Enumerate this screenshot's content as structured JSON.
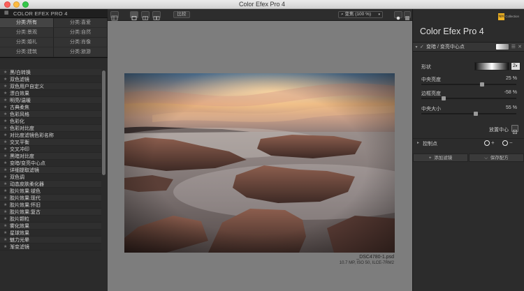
{
  "window": {
    "title": "Color Efex Pro 4"
  },
  "left_panel": {
    "header": "COLOR EFEX PRO 4",
    "categories": [
      "分类:所有",
      "分类:喜爱",
      "分类:景观",
      "分类:自然",
      "分类:婚礼",
      "分类:肖像",
      "分类:建筑",
      "分类:旅游"
    ],
    "filters": [
      "黑/白转换",
      "双色滤镜",
      "双色用户自定义",
      "漂白效果",
      "明亮/温暖",
      "古典柔焦",
      "色彩风格",
      "色彩化",
      "色彩对比度",
      "对比度滤镜色彩名称",
      "交叉平衡",
      "交叉冲印",
      "黑暗对比度",
      "变暗/变亮中心点",
      "详细提取滤镜",
      "双色调",
      "动态皮肤柔化器",
      "胶片效果:褪色",
      "胶片效果:现代",
      "胶片效果:怀旧",
      "胶片效果:复古",
      "胶片颗粒",
      "雾化效果",
      "星球效果",
      "魅力光晕",
      "渐变滤镜"
    ]
  },
  "toolbar": {
    "compare_label": "比较",
    "zoom_label": "变焦 (100 %)"
  },
  "canvas": {
    "file_name": "_DSC4780-1.psd",
    "file_info": "10.7 MP, ISO 50, ILCE-7RM2"
  },
  "right_panel": {
    "brand_title": "Color Efex Pro",
    "brand_version": "4",
    "logo_text": "NIK",
    "logo_sub": "Collection",
    "filter_name": "变暗 / 变亮中心点",
    "shape_label": "形状",
    "shape_value": "2",
    "controls": [
      {
        "label": "中央亮度",
        "value": "25 %",
        "fraction": 0.62
      },
      {
        "label": "边框亮度",
        "value": "-58 %",
        "fraction": 0.21
      },
      {
        "label": "中央大小",
        "value": "55 %",
        "fraction": 0.55
      }
    ],
    "place_center_label": "放置中心",
    "control_points_label": "控制点",
    "add_filter_label": "添加滤镜",
    "save_recipe_label": "保存配方"
  },
  "colors": {
    "accent": "#f0b323",
    "panel_bg": "#2c2c2c",
    "canvas_bg": "#7d7d7d"
  }
}
